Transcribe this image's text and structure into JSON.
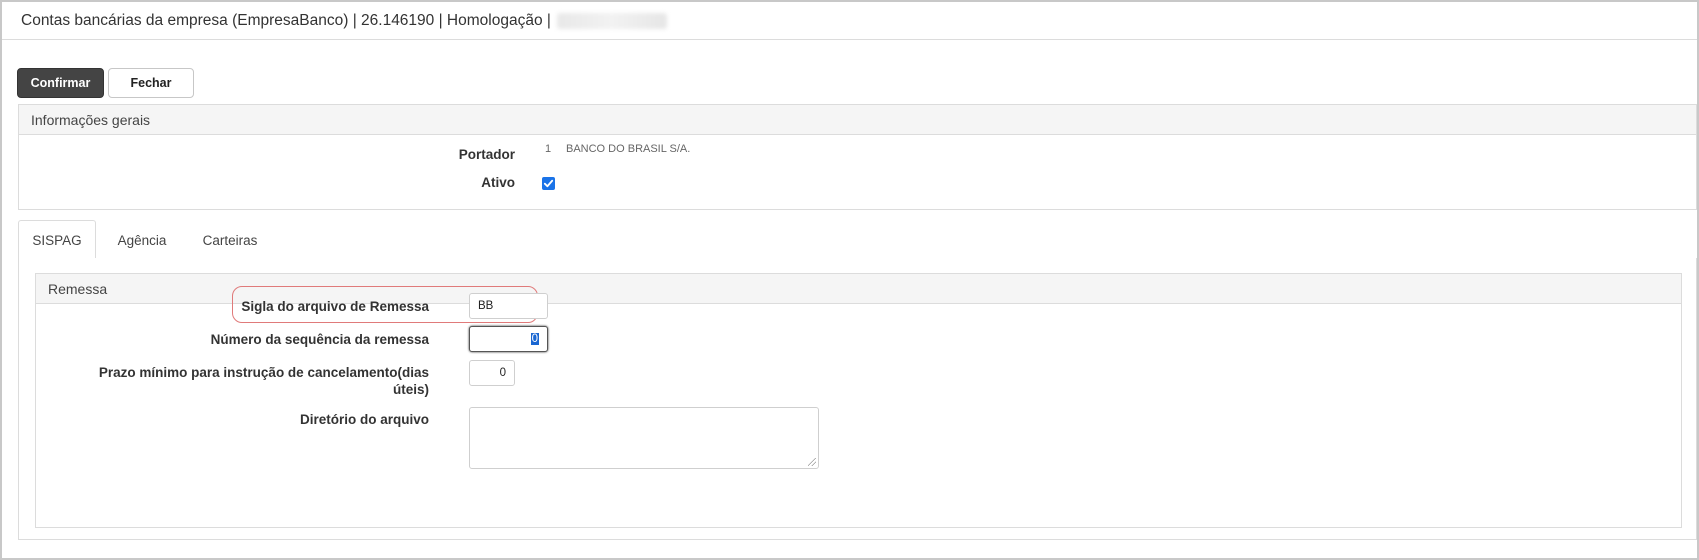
{
  "window": {
    "title": "Contas bancárias da empresa (EmpresaBanco) | 26.146190 | Homologação |"
  },
  "toolbar": {
    "confirm_label": "Confirmar",
    "close_label": "Fechar"
  },
  "general": {
    "header": "Informações gerais",
    "portador_label": "Portador",
    "portador_code": "1",
    "portador_name": "BANCO DO BRASIL S/A.",
    "ativo_label": "Ativo",
    "ativo_checked": true
  },
  "tabs": [
    {
      "label": "SISPAG",
      "active": true
    },
    {
      "label": "Agência",
      "active": false
    },
    {
      "label": "Carteiras",
      "active": false
    }
  ],
  "remessa": {
    "header": "Remessa",
    "sigla_label": "Sigla do arquivo de Remessa",
    "sigla_value": "BB",
    "sequencia_label": "Número da sequência da remessa",
    "sequencia_value": "0",
    "prazo_label_line1": "Prazo mínimo para instrução de cancelamento(dias",
    "prazo_label_line2": "úteis)",
    "prazo_value": "0",
    "diretorio_label": "Diretório do arquivo",
    "diretorio_value": ""
  },
  "colors": {
    "accent": "#1a73e8",
    "highlight": "#e07a7a",
    "primary_button": "#444444"
  }
}
